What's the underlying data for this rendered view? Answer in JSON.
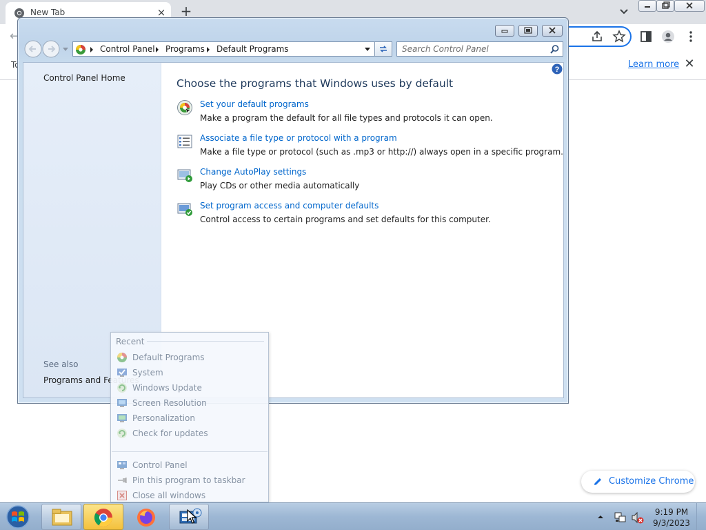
{
  "chrome": {
    "tab_title": "New Tab",
    "tab_close_glyph": "×",
    "new_tab_glyph": "+",
    "back_glyph": "←",
    "info_truncated": "To",
    "learn_more": "Learn more",
    "info_close_glyph": "✕",
    "customize_label": "Customize Chrome",
    "accent": "#1a73e8"
  },
  "window": {
    "breadcrumb": [
      "Control Panel",
      "Programs",
      "Default Programs"
    ],
    "search_placeholder": "Search Control Panel",
    "sidebar": {
      "home": "Control Panel Home",
      "see_also": "See also",
      "programs_features": "Programs and Features"
    },
    "title": "Choose the programs that Windows uses by default",
    "tasks": [
      {
        "icon": "default-programs-icon",
        "link": "Set your default programs",
        "desc": "Make a program the default for all file types and protocols it can open."
      },
      {
        "icon": "file-association-icon",
        "link": "Associate a file type or protocol with a program",
        "desc": "Make a file type or protocol (such as .mp3 or http://) always open in a specific program."
      },
      {
        "icon": "autoplay-icon",
        "link": "Change AutoPlay settings",
        "desc": "Play CDs or other media automatically"
      },
      {
        "icon": "program-access-icon",
        "link": "Set program access and computer defaults",
        "desc": "Control access to certain programs and set defaults for this computer."
      }
    ],
    "link_color": "#0066cc",
    "title_color": "#1e395b"
  },
  "jumplist": {
    "header": "Recent",
    "recent": [
      {
        "label": "Default Programs",
        "icon": "default-programs-icon"
      },
      {
        "label": "System",
        "icon": "system-icon"
      },
      {
        "label": "Windows Update",
        "icon": "windows-update-icon"
      },
      {
        "label": "Screen Resolution",
        "icon": "screen-resolution-icon"
      },
      {
        "label": "Personalization",
        "icon": "personalization-icon"
      },
      {
        "label": "Check for updates",
        "icon": "check-updates-icon"
      }
    ],
    "tasks": [
      {
        "label": "Control Panel",
        "icon": "control-panel-icon"
      },
      {
        "label": "Pin this program to taskbar",
        "icon": "pin-icon"
      },
      {
        "label": "Close all windows",
        "icon": "close-windows-icon"
      }
    ]
  },
  "taskbar": {
    "time": "9:19 PM",
    "date": "9/3/2023",
    "apps": [
      "file-explorer-icon",
      "chrome-icon",
      "firefox-icon",
      "control-panel-icon"
    ]
  }
}
